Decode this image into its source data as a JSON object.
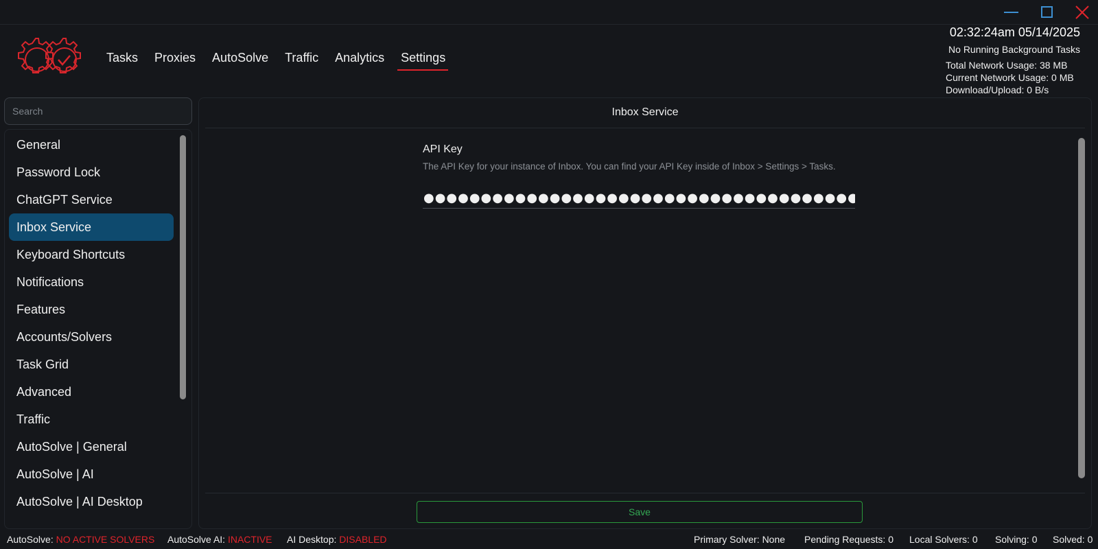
{
  "window": {
    "controls": {
      "minimize_icon": "minimize-icon",
      "maximize_icon": "maximize-icon",
      "close_icon": "close-icon"
    },
    "colors": {
      "minimize": "#3d8fd1",
      "maximize": "#3d8fd1",
      "close": "#e0242b"
    }
  },
  "header": {
    "logo": "gear-check-logo",
    "nav": [
      {
        "label": "Tasks",
        "active": false
      },
      {
        "label": "Proxies",
        "active": false
      },
      {
        "label": "AutoSolve",
        "active": false
      },
      {
        "label": "Traffic",
        "active": false
      },
      {
        "label": "Analytics",
        "active": false
      },
      {
        "label": "Settings",
        "active": true
      }
    ],
    "clock": "02:32:24am 05/14/2025",
    "background_tasks": "No Running Background Tasks",
    "network": {
      "total": "Total Network Usage:  38 MB",
      "current": "Current Network Usage: 0 MB",
      "rate": "Download/Upload: 0 B/s"
    }
  },
  "sidebar": {
    "search_placeholder": "Search",
    "items": [
      {
        "label": "General"
      },
      {
        "label": "Password Lock"
      },
      {
        "label": "ChatGPT Service"
      },
      {
        "label": "Inbox Service"
      },
      {
        "label": "Keyboard Shortcuts"
      },
      {
        "label": "Notifications"
      },
      {
        "label": "Features"
      },
      {
        "label": "Accounts/Solvers"
      },
      {
        "label": "Task Grid"
      },
      {
        "label": "Advanced"
      },
      {
        "label": "Traffic"
      },
      {
        "label": "AutoSolve | General"
      },
      {
        "label": "AutoSolve | AI"
      },
      {
        "label": "AutoSolve | AI Desktop"
      }
    ],
    "active_index": 3
  },
  "main": {
    "title": "Inbox Service",
    "field": {
      "label": "API Key",
      "description": "The API Key for your instance of Inbox. You can find your API Key inside of Inbox > Settings > Tasks.",
      "value": "●●●●●●●●●●●●●●●●●●●●●●●●●●●●●●●●●●●●●●●●●●●●"
    },
    "save_label": "Save",
    "accent_color": "#34a853",
    "active_color": "#0e4a6e"
  },
  "status_bar": {
    "autosolve_label": "AutoSolve:",
    "autosolve_value": "NO ACTIVE SOLVERS",
    "autosolve_ai_label": "AutoSolve AI:",
    "autosolve_ai_value": "INACTIVE",
    "ai_desktop_label": "AI Desktop:",
    "ai_desktop_value": "DISABLED",
    "primary_solver": "Primary Solver: None",
    "pending_requests": "Pending Requests: 0",
    "local_solvers": "Local Solvers: 0",
    "solving": "Solving: 0",
    "solved": "Solved: 0",
    "alert_color": "#e0242b"
  }
}
